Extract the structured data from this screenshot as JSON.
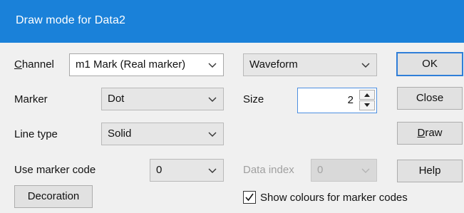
{
  "window": {
    "title": "Draw mode for Data2"
  },
  "labels": {
    "channel": "Channel",
    "marker": "Marker",
    "line_type": "Line type",
    "use_marker_code": "Use marker code",
    "size": "Size",
    "data_index": "Data index"
  },
  "combos": {
    "channel": "m1 Mark (Real marker)",
    "mode": "Waveform",
    "marker": "Dot",
    "line_type": "Solid",
    "marker_code": "0",
    "data_index": "0"
  },
  "size": {
    "value": "2"
  },
  "buttons": {
    "ok": "OK",
    "close": "Close",
    "draw": "Draw",
    "help": "Help",
    "decoration": "Decoration"
  },
  "checkbox": {
    "show_colours": "Show colours for marker codes",
    "checked": true
  },
  "icons": {
    "dropdown": "chevron-down-icon",
    "spin_up": "arrow-up-icon",
    "spin_down": "arrow-down-icon",
    "check": "check-icon"
  }
}
